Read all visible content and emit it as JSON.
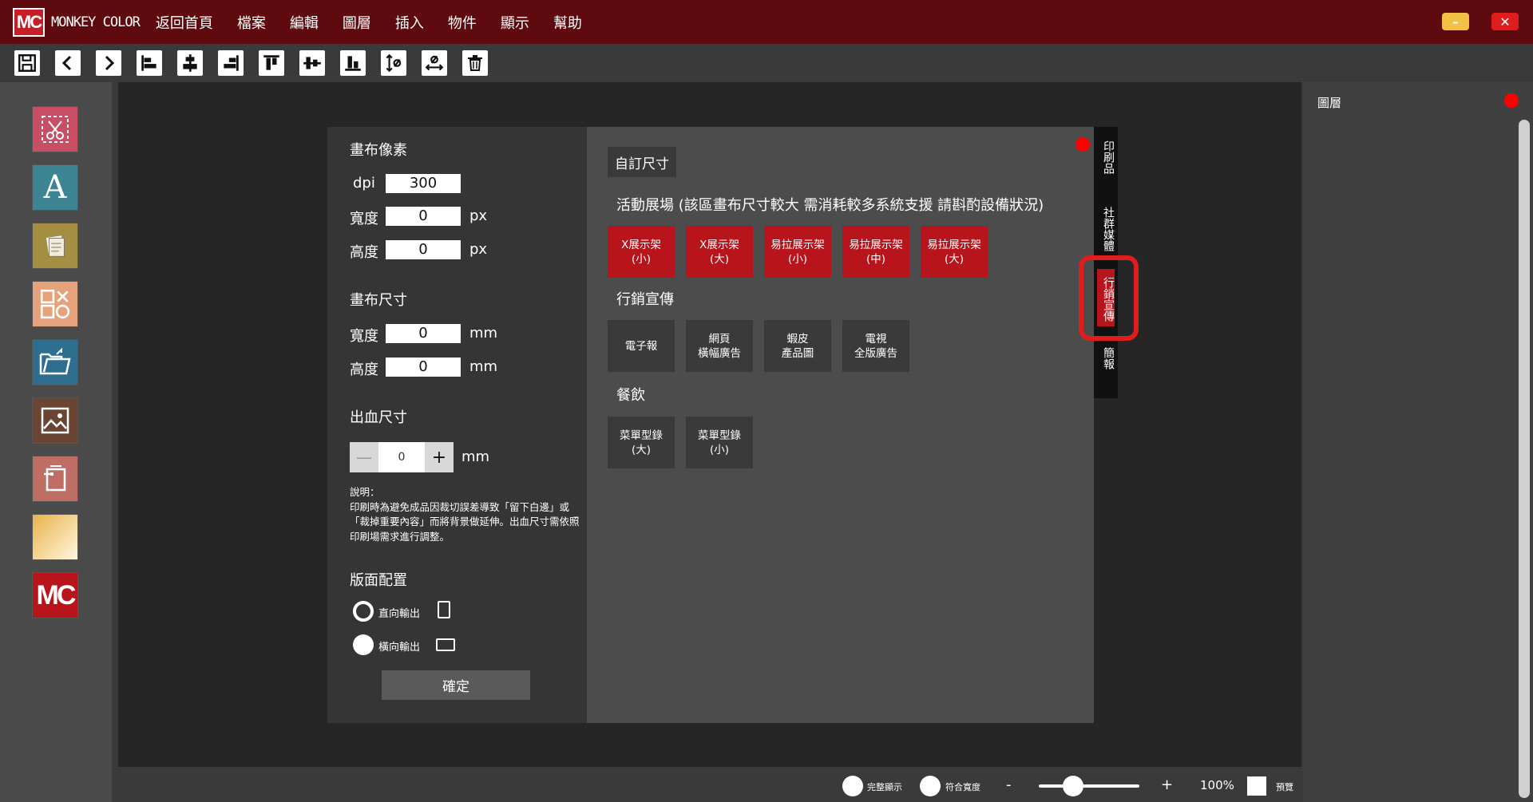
{
  "app": {
    "logo": "MC",
    "brand": "MONKEY COLOR",
    "menu": [
      "返回首頁",
      "檔案",
      "編輯",
      "圖層",
      "插入",
      "物件",
      "顯示",
      "幫助"
    ],
    "minimize_glyph": "–",
    "close_glyph": "✕"
  },
  "toolbar": {
    "icons": [
      "save-icon",
      "undo-icon",
      "redo-icon",
      "align-left-icon",
      "align-center-icon",
      "align-right-icon",
      "align-top-icon",
      "align-middle-icon",
      "align-bottom-icon",
      "distribute-vertical-icon",
      "distribute-horizontal-icon",
      "delete-icon"
    ]
  },
  "left_tools": [
    "crop-icon",
    "text-icon",
    "notes-icon",
    "shapes-icon",
    "open-folder-icon",
    "image-icon",
    "frame-icon",
    "gradient-icon",
    "mc-logo-icon"
  ],
  "settings": {
    "pixels_title": "畫布像素",
    "dpi_label": "dpi",
    "dpi_value": "300",
    "width_label": "寬度",
    "width_px": "0",
    "height_label": "高度",
    "height_px": "0",
    "px_unit": "px",
    "size_title": "畫布尺寸",
    "width_mm": "0",
    "height_mm": "0",
    "mm_unit": "mm",
    "bleed_title": "出血尺寸",
    "bleed_minus": "—",
    "bleed_value": "0",
    "bleed_plus": "+",
    "note_title": "說明：",
    "note_body": "印刷時為避免成品因裁切誤差導致「留下白邊」或「裁掉重要內容」而將背景做延伸。出血尺寸需依照印刷場需求進行調整。",
    "layout_title": "版面配置",
    "portrait_label": "直向輸出",
    "landscape_label": "橫向輸出",
    "confirm": "確定"
  },
  "presets": {
    "custom_tab": "自訂尺寸",
    "event_title": "活動展場 (該區畫布尺寸較大 需消耗較多系統支援 請斟酌設備狀況)",
    "event_items": [
      [
        "X展示架",
        "(小)"
      ],
      [
        "X展示架",
        "(大)"
      ],
      [
        "易拉展示架",
        "(小)"
      ],
      [
        "易拉展示架",
        "(中)"
      ],
      [
        "易拉展示架",
        "(大)"
      ]
    ],
    "marketing_title": "行銷宣傳",
    "marketing_items": [
      [
        "電子報",
        ""
      ],
      [
        "網頁",
        "橫幅廣告"
      ],
      [
        "蝦皮",
        "產品圖"
      ],
      [
        "電視",
        "全版廣告"
      ]
    ],
    "food_title": "餐飲",
    "food_items": [
      [
        "菜單型錄",
        "(大)"
      ],
      [
        "菜單型錄",
        "(小)"
      ]
    ]
  },
  "category_tabs": [
    "印刷品",
    "社群媒體",
    "行銷宣傳",
    "簡報"
  ],
  "right_panel": {
    "title": "圖層"
  },
  "bottom": {
    "fit_all": "完整顯示",
    "fit_width": "符合寬度",
    "zoom_minus": "-",
    "zoom_plus": "+",
    "zoom": "100%",
    "preview": "預覽"
  },
  "colors": {
    "titlebar": "#5e0a0e",
    "accent": "#b8141c",
    "highlight": "#e01d1d"
  }
}
